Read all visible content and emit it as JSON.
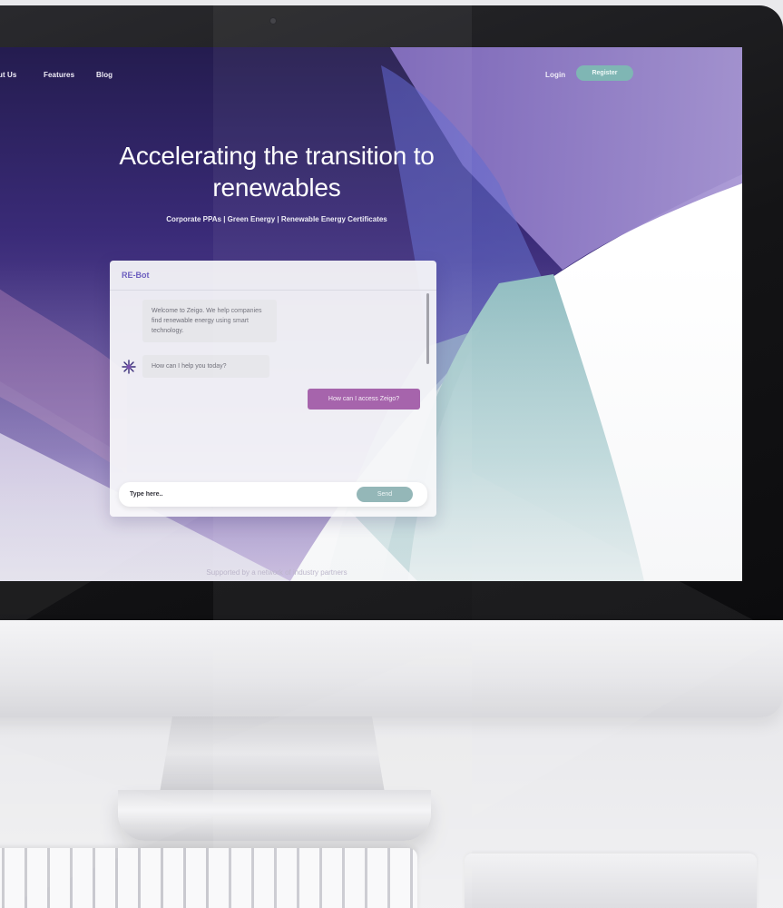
{
  "nav": {
    "about_label": "out Us",
    "features_label": "Features",
    "blog_label": "Blog",
    "login_label": "Login",
    "register_label": "Register"
  },
  "hero": {
    "title": "Accelerating the transition to renewables",
    "subtitle": "Corporate PPAs | Green Energy | Renewable Energy Certificates"
  },
  "chat": {
    "title": "RE-Bot",
    "bot_messages": [
      "Welcome to Zeigo. We help companies find renewable energy using smart technology.",
      "How can I help you today?"
    ],
    "user_message": "How can I access Zeigo?",
    "input_placeholder": "Type here..",
    "send_label": "Send"
  },
  "footer": {
    "partners_text": "Supported by a network of industry partners"
  },
  "colors": {
    "hero_purple": "#3c2a78",
    "lavender": "#9a86cc",
    "teal": "#7fb6b4",
    "user_bubble": "#a25ca8",
    "bot_title": "#6d5fbf"
  },
  "icons": {
    "bot_avatar": "starburst-icon"
  }
}
